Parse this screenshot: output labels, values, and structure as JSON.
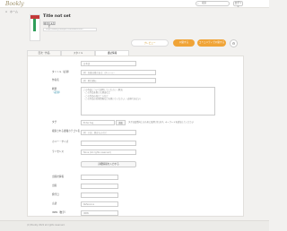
{
  "header": {
    "logo": "Bookly",
    "search_placeholder": "検索",
    "login_label": "ログイン",
    "breadcrumb": "ホーム"
  },
  "book": {
    "title": "Title not set",
    "author_badge": "著者名未設定",
    "url": "https://bookly.example.com/books/0000"
  },
  "actions": {
    "preview": "プレビュー",
    "publish": "公開する",
    "publish_settings": "コミュニティで公開する"
  },
  "tabs": [
    {
      "label": "目次・作品"
    },
    {
      "label": "スタイル"
    },
    {
      "label": "書誌情報"
    }
  ],
  "form": {
    "language": {
      "label": "",
      "value": "日本語"
    },
    "title": {
      "label": "タイトル（必須）",
      "placeholder": "例：吾輩は猫である（タイトル）"
    },
    "author": {
      "label": "作者名",
      "placeholder": "例：夏目漱石"
    },
    "summary": {
      "label": "概要",
      "required_hint": "（必須）",
      "placeholder": "この作品について説明してください（例文）\n・この作品を書いた理由など\n・この作品の見どころなど\n・この作品の背景情報などを書いてください。（必須ではない）"
    },
    "tags": {
      "label": "タグ",
      "placeholder": "Enter tag",
      "add_button": "追加",
      "hint": "タグは品質向上のために使用されます。キーワードを追加してください"
    },
    "category": {
      "label": "検索される書籍カテゴリ名",
      "placeholder": "例：小説、歴史ものなど"
    },
    "cover_size": {
      "label": "カバー・サイズ",
      "value": ""
    },
    "license": {
      "label": "ライセンス",
      "value": "None (All rights reserved)"
    },
    "detail_button": "詳細情報を入力する",
    "extra_fields": [
      {
        "label": "出版社情報",
        "value": ""
      },
      {
        "label": "出版",
        "value": ""
      },
      {
        "label": "発行日",
        "value": ""
      },
      {
        "label": "言語",
        "value": "Reference"
      },
      {
        "label": "ISBN（数字）",
        "value": "ISBN"
      }
    ]
  },
  "footer": {
    "copyright": "(C) Bookly 2022 all rights reserved."
  }
}
